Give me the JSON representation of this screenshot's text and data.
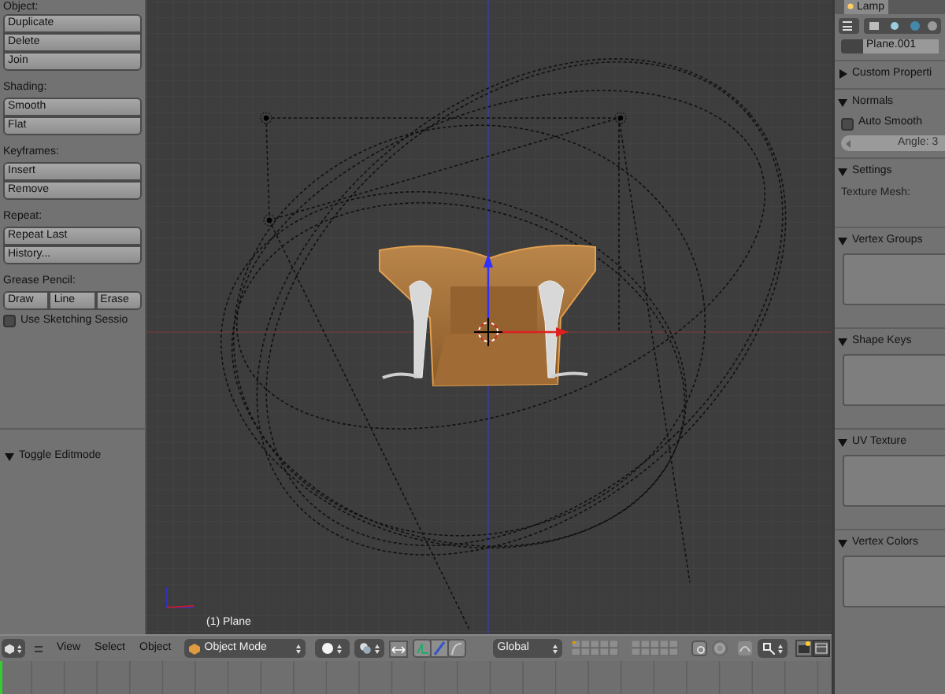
{
  "tool_shelf": {
    "sections": [
      {
        "kind": "stack",
        "label": "Object:",
        "buttons": [
          "Duplicate",
          "Delete",
          "Join"
        ]
      },
      {
        "kind": "stack",
        "label": "Shading:",
        "buttons": [
          "Smooth",
          "Flat"
        ]
      },
      {
        "kind": "stack",
        "label": "Keyframes:",
        "buttons": [
          "Insert",
          "Remove"
        ]
      },
      {
        "kind": "stack",
        "label": "Repeat:",
        "buttons": [
          "Repeat Last",
          "History..."
        ]
      },
      {
        "kind": "row",
        "label": "Grease Pencil:",
        "buttons": [
          "Draw",
          "Line",
          "Erase"
        ]
      }
    ],
    "sketching": {
      "label": "Use Sketching Sessio",
      "checked": false
    },
    "operator_panel": {
      "title": "Toggle Editmode",
      "expanded": true
    }
  },
  "viewport": {
    "object_label": "(1) Plane"
  },
  "header": {
    "editor_menus": [
      "View",
      "Select",
      "Object"
    ],
    "mode": "Object Mode",
    "orientation": "Global"
  },
  "properties": {
    "tab": "Lamp",
    "datablock_name": "Plane.001",
    "panels": [
      {
        "title": "Custom Properti",
        "expanded": false
      },
      {
        "title": "Normals",
        "expanded": true,
        "items": [
          {
            "kind": "checkbox",
            "label": "Auto Smooth",
            "checked": false
          },
          {
            "kind": "number_field",
            "label": "Angle: 3"
          }
        ]
      },
      {
        "title": "Settings",
        "expanded": true,
        "items": [
          {
            "kind": "label",
            "label": "Texture Mesh:"
          }
        ]
      },
      {
        "title": "Vertex Groups",
        "expanded": true,
        "items": [
          {
            "kind": "list"
          }
        ]
      },
      {
        "title": "Shape Keys",
        "expanded": true,
        "items": [
          {
            "kind": "list"
          }
        ]
      },
      {
        "title": "UV Texture",
        "expanded": true,
        "items": [
          {
            "kind": "list"
          }
        ]
      },
      {
        "title": "Vertex Colors",
        "expanded": true,
        "items": [
          {
            "kind": "list"
          }
        ]
      }
    ]
  }
}
